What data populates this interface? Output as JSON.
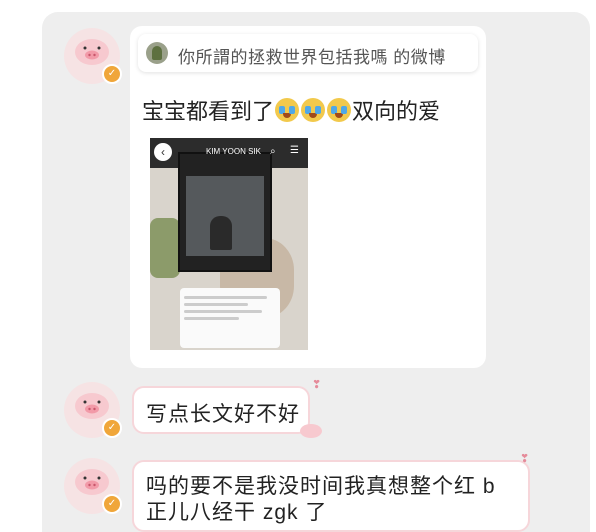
{
  "conversation": {
    "card": {
      "header_title": "你所謂的拯救世界包括我嗎 的微博",
      "post_text_before": "宝宝都看到了",
      "post_emojis": [
        "crying-face-icon",
        "crying-face-icon",
        "crying-face-icon"
      ],
      "post_text_after": "双向的爱",
      "thumbnail": {
        "title": "KIM YOON SIK"
      }
    },
    "messages": [
      {
        "text": "写点长文好不好"
      },
      {
        "line1": "吗的要不是我没时间我真想整个红 b",
        "line2": "正儿八经干 zgk 了"
      }
    ]
  },
  "colors": {
    "chat_background": "#eeeeee",
    "bubble_border": "#f6d6da",
    "badge": "#f0a63a",
    "avatar": "#f6e3e4"
  }
}
